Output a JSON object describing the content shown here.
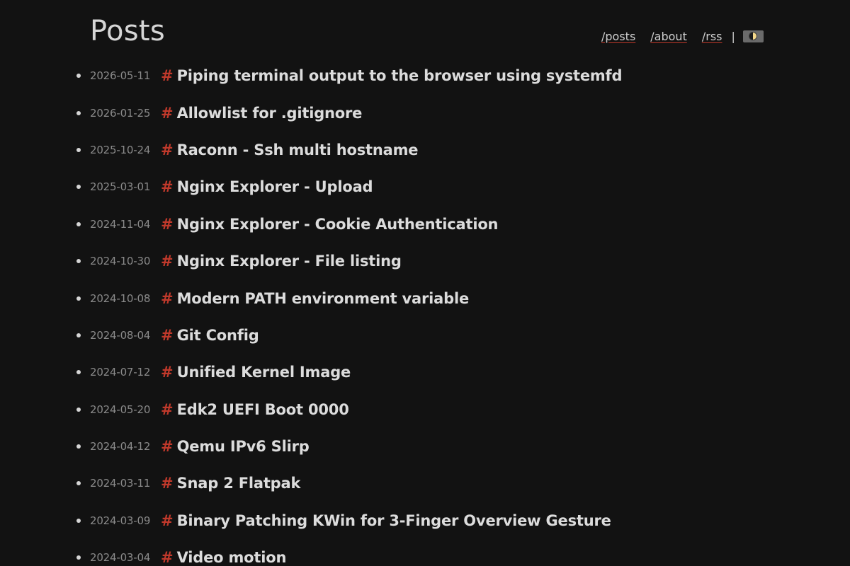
{
  "header": {
    "title": "Posts",
    "nav": [
      {
        "label": "/posts"
      },
      {
        "label": "/about"
      },
      {
        "label": "/rss"
      }
    ],
    "separator": "|",
    "theme_toggle_icon": "half-moon-icon"
  },
  "colors": {
    "background": "#121212",
    "accent": "#c0392b",
    "text": "#dcdcdc",
    "date": "#8a8a8a"
  },
  "posts": [
    {
      "date": "2026-05-11",
      "hash": "#",
      "title": "Piping terminal output to the browser using systemfd"
    },
    {
      "date": "2026-01-25",
      "hash": "#",
      "title": "Allowlist for .gitignore"
    },
    {
      "date": "2025-10-24",
      "hash": "#",
      "title": "Raconn - Ssh multi hostname"
    },
    {
      "date": "2025-03-01",
      "hash": "#",
      "title": "Nginx Explorer - Upload"
    },
    {
      "date": "2024-11-04",
      "hash": "#",
      "title": "Nginx Explorer - Cookie Authentication"
    },
    {
      "date": "2024-10-30",
      "hash": "#",
      "title": "Nginx Explorer - File listing"
    },
    {
      "date": "2024-10-08",
      "hash": "#",
      "title": "Modern PATH environment variable"
    },
    {
      "date": "2024-08-04",
      "hash": "#",
      "title": "Git Config"
    },
    {
      "date": "2024-07-12",
      "hash": "#",
      "title": "Unified Kernel Image"
    },
    {
      "date": "2024-05-20",
      "hash": "#",
      "title": "Edk2 UEFI Boot 0000"
    },
    {
      "date": "2024-04-12",
      "hash": "#",
      "title": "Qemu IPv6 Slirp"
    },
    {
      "date": "2024-03-11",
      "hash": "#",
      "title": "Snap 2 Flatpak"
    },
    {
      "date": "2024-03-09",
      "hash": "#",
      "title": "Binary Patching KWin for 3-Finger Overview Gesture"
    },
    {
      "date": "2024-03-04",
      "hash": "#",
      "title": "Video motion"
    }
  ]
}
